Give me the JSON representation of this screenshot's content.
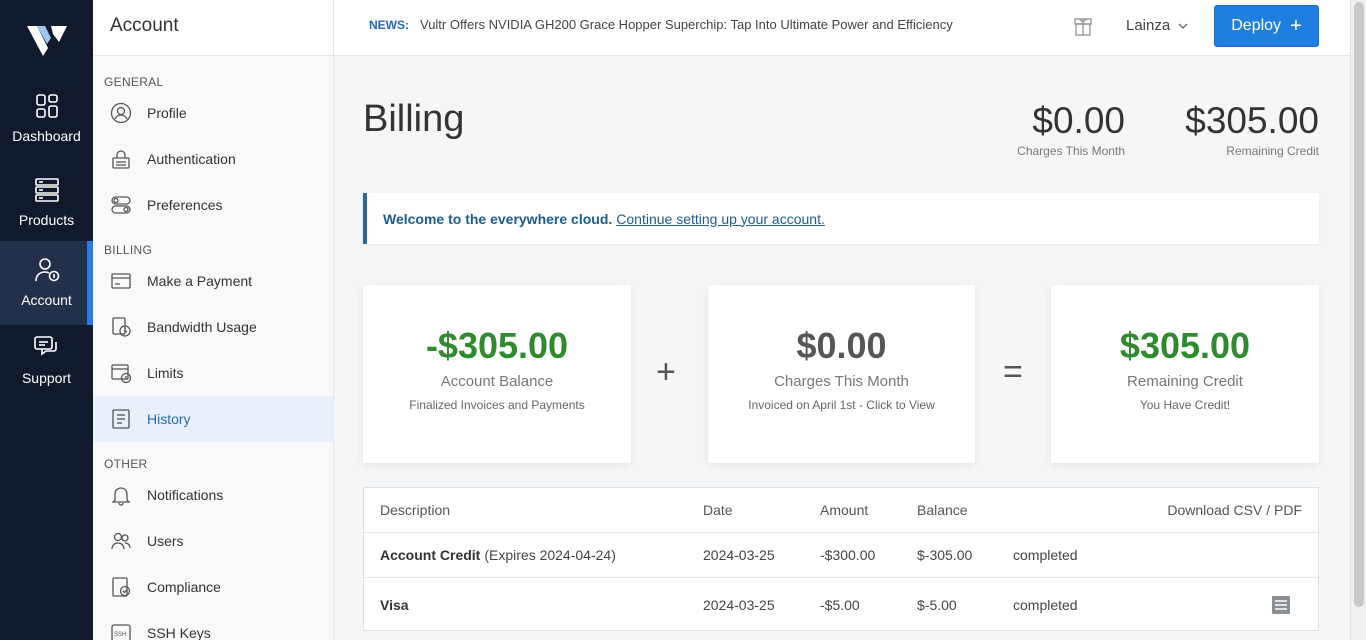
{
  "leftnav": {
    "items": [
      {
        "label": "Dashboard",
        "icon": "dashboard-icon"
      },
      {
        "label": "Products",
        "icon": "products-icon"
      },
      {
        "label": "Account",
        "icon": "account-icon",
        "active": true
      },
      {
        "label": "Support",
        "icon": "support-icon"
      }
    ]
  },
  "sidebar": {
    "title": "Account",
    "sections": {
      "general": "GENERAL",
      "billing": "BILLING",
      "other": "OTHER"
    },
    "items": [
      {
        "label": "Profile",
        "icon": "profile-icon"
      },
      {
        "label": "Authentication",
        "icon": "lock-icon"
      },
      {
        "label": "Preferences",
        "icon": "toggle-icon"
      },
      {
        "label": "Make a Payment",
        "icon": "credit-card-icon"
      },
      {
        "label": "Bandwidth Usage",
        "icon": "bandwidth-icon"
      },
      {
        "label": "Limits",
        "icon": "limits-icon"
      },
      {
        "label": "History",
        "icon": "history-icon",
        "active": true
      },
      {
        "label": "Notifications",
        "icon": "bell-icon"
      },
      {
        "label": "Users",
        "icon": "users-icon"
      },
      {
        "label": "Compliance",
        "icon": "compliance-icon"
      },
      {
        "label": "SSH Keys",
        "icon": "ssh-key-icon"
      }
    ]
  },
  "topbar": {
    "news_label": "NEWS:",
    "news_text": "Vultr Offers NVIDIA GH200 Grace Hopper Superchip: Tap Into Ultimate Power and Efficiency",
    "user": "Lainza",
    "deploy_label": "Deploy",
    "deploy_plus": "+"
  },
  "page": {
    "title": "Billing",
    "charges_amount": "$0.00",
    "charges_label": "Charges This Month",
    "remaining_amount": "$305.00",
    "remaining_label": "Remaining Credit"
  },
  "welcome": {
    "bold": "Welcome to the everywhere cloud.",
    "link": "Continue setting up your account."
  },
  "cards": {
    "balance": {
      "amount": "-$305.00",
      "label": "Account Balance",
      "sub": "Finalized Invoices and Payments"
    },
    "charges": {
      "amount": "$0.00",
      "label": "Charges This Month",
      "sub": "Invoiced on April 1st - Click to View"
    },
    "remaining": {
      "amount": "$305.00",
      "label": "Remaining Credit",
      "sub": "You Have Credit!"
    },
    "plus": "+",
    "equals": "="
  },
  "colors": {
    "green": "#2e8b2e",
    "gray_amount": "#555555",
    "accent": "#1f7fe0"
  },
  "table": {
    "headers": {
      "description": "Description",
      "date": "Date",
      "amount": "Amount",
      "balance": "Balance",
      "download": "Download CSV / PDF"
    },
    "rows": [
      {
        "desc_bold": "Account Credit",
        "desc_rest": "(Expires 2024-04-24)",
        "date": "2024-03-25",
        "amount": "-$300.00",
        "balance": "$-305.00",
        "status": "completed"
      },
      {
        "desc_bold": "Visa",
        "desc_rest": "",
        "date": "2024-03-25",
        "amount": "-$5.00",
        "balance": "$-5.00",
        "status": "completed",
        "icon": "document-icon"
      }
    ]
  }
}
